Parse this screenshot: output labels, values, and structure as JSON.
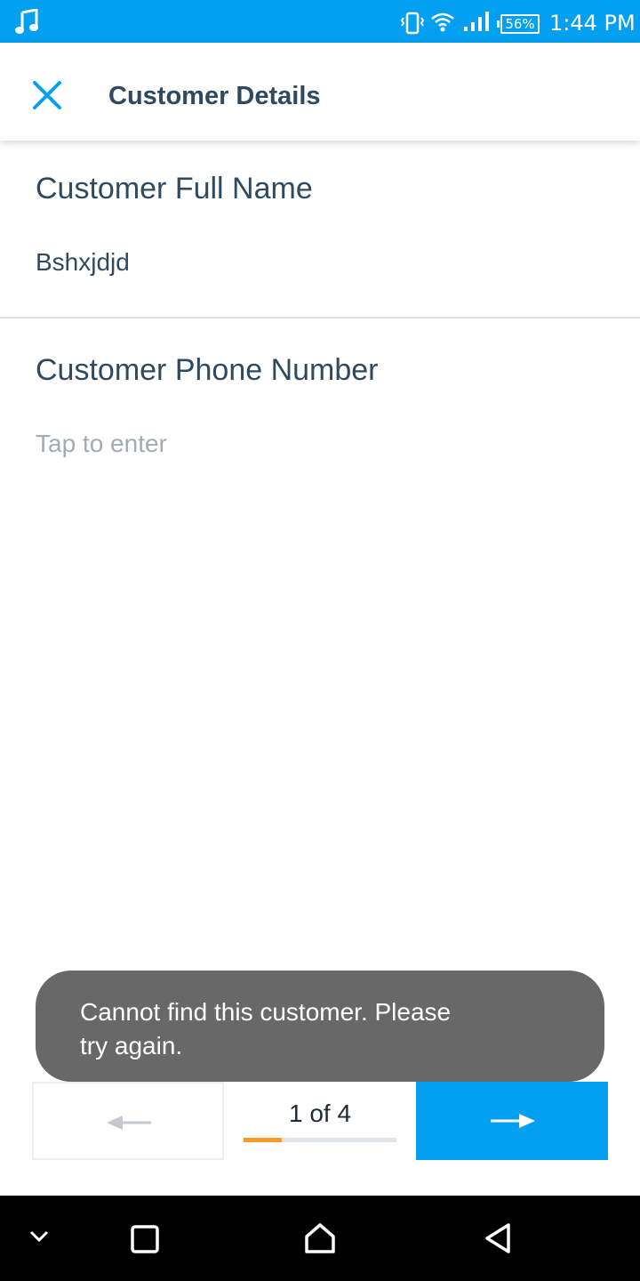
{
  "status_bar": {
    "battery_percent": "56%",
    "time": "1:44 PM",
    "icons": [
      "music-note-icon",
      "vibrate-icon",
      "wifi-icon",
      "signal-icon",
      "battery-icon"
    ]
  },
  "header": {
    "title": "Customer Details",
    "close_icon": "close-icon"
  },
  "fields": [
    {
      "label": "Customer Full Name",
      "value": "Bshxjdjd"
    },
    {
      "label": "Customer Phone Number",
      "placeholder": "Tap to enter"
    }
  ],
  "toast": {
    "message": "Cannot find this customer. Please try again."
  },
  "pager": {
    "counter": "1 of 4",
    "progress_fraction": 0.25,
    "prev_icon": "arrow-left-icon",
    "next_icon": "arrow-right-icon"
  },
  "colors": {
    "primary": "#03a0f2",
    "text": "#2f4a60",
    "placeholder": "#a0acb6",
    "progress": "#f49a2b",
    "toast_bg": "#686868"
  },
  "nav_bar": {
    "icons": [
      "chevron-down-icon",
      "recents-icon",
      "home-icon",
      "back-icon"
    ]
  }
}
